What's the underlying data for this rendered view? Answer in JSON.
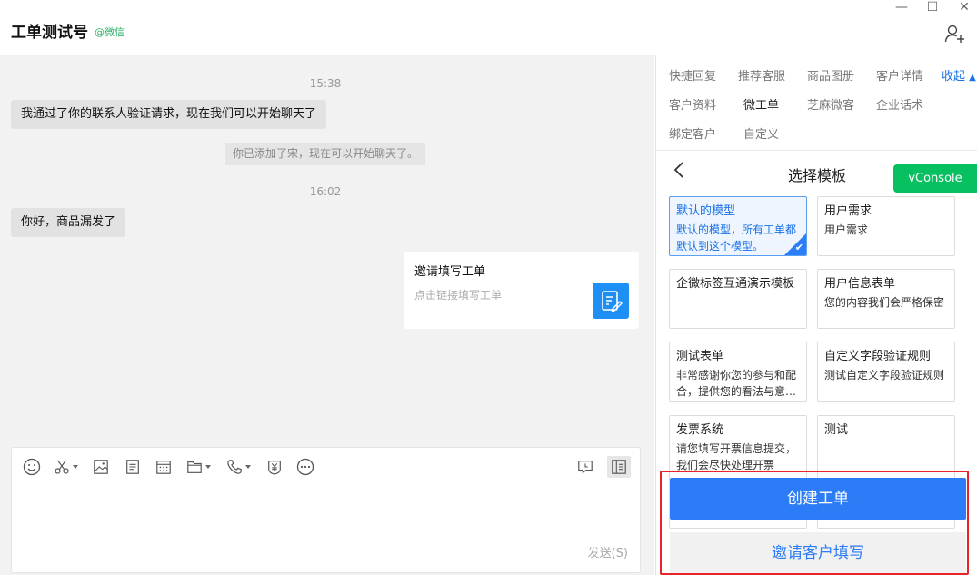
{
  "window": {
    "title": "工单测试号",
    "source": "@微信",
    "controls": [
      "—",
      "☐",
      "✕"
    ]
  },
  "chat": {
    "messages": [
      {
        "type": "time",
        "text": "15:38"
      },
      {
        "type": "in",
        "text": "我通过了你的联系人验证请求，现在我们可以开始聊天了"
      },
      {
        "type": "system",
        "text": "你已添加了宋，现在可以开始聊天了。"
      },
      {
        "type": "time",
        "text": "16:02"
      },
      {
        "type": "in",
        "text": "你好，商品漏发了"
      }
    ],
    "card": {
      "title": "邀请填写工单",
      "subtitle": "点击链接填写工单"
    }
  },
  "composer": {
    "send_label": "发送(S)"
  },
  "panel": {
    "tabs": [
      "快捷回复",
      "推荐客服",
      "商品图册",
      "客户详情",
      "客户资料",
      "微工单",
      "芝麻微客",
      "企业话术",
      "绑定客户",
      "自定义"
    ],
    "active_tab": "微工单",
    "collapse_label": "收起",
    "sub_title": "选择模板",
    "vconsole_label": "vConsole",
    "templates": [
      {
        "name": "默认的模型",
        "desc": "默认的模型，所有工单都默认到这个模型。",
        "selected": true
      },
      {
        "name": "用户需求",
        "desc": "用户需求"
      },
      {
        "name": "企微标签互通演示模板",
        "desc": ""
      },
      {
        "name": "用户信息表单",
        "desc": "您的内容我们会严格保密"
      },
      {
        "name": "测试表单",
        "desc": "非常感谢你您的参与和配合，提供您的看法与意…"
      },
      {
        "name": "自定义字段验证规则",
        "desc": "测试自定义字段验证规则"
      },
      {
        "name": "发票系统",
        "desc": "请您填写开票信息提交，我们会尽快处理开票"
      },
      {
        "name": "测试",
        "desc": ""
      }
    ],
    "create_button": "创建工单",
    "invite_button": "邀请客户填写"
  },
  "colors": {
    "accent": "#2b7cf6",
    "brand_green": "#07c160",
    "highlight_red": "#e8232a"
  }
}
